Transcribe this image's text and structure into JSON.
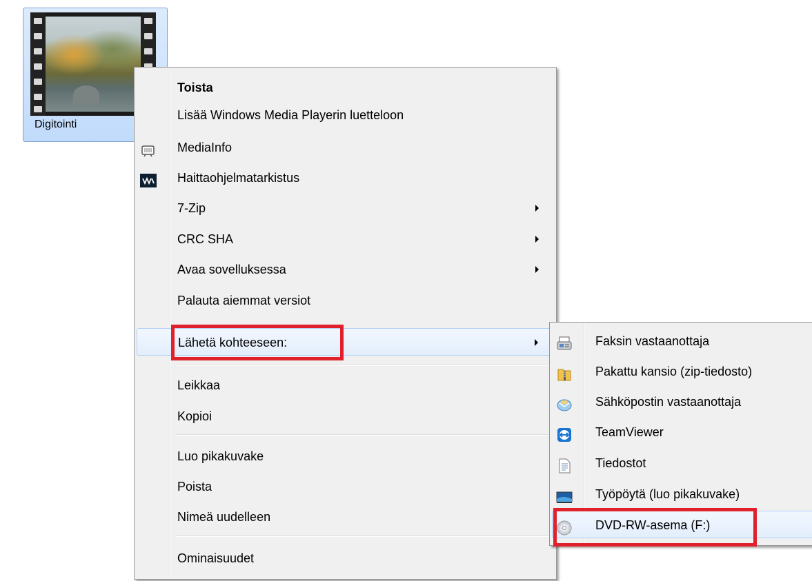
{
  "file": {
    "label": "Digitointi",
    "icon": "video-thumbnail-icon"
  },
  "context_menu": {
    "items": [
      {
        "label": "Toista",
        "bold": true
      },
      {
        "label": "Lisää Windows Media Playerin luetteloon"
      },
      {
        "label": "MediaInfo",
        "icon": "mediainfo-icon"
      },
      {
        "label": "Haittaohjelmatarkistus",
        "icon": "malware-scan-icon"
      },
      {
        "label": "7-Zip",
        "submenu": true
      },
      {
        "label": "CRC SHA",
        "submenu": true
      },
      {
        "label": "Avaa sovelluksessa",
        "submenu": true
      },
      {
        "label": "Palauta aiemmat versiot"
      },
      {
        "label": "Lähetä kohteeseen:",
        "submenu": true,
        "highlighted": true
      },
      {
        "label": "Leikkaa"
      },
      {
        "label": "Kopioi"
      },
      {
        "label": "Luo pikakuvake"
      },
      {
        "label": "Poista"
      },
      {
        "label": "Nimeä uudelleen"
      },
      {
        "label": "Ominaisuudet"
      }
    ]
  },
  "send_to_menu": {
    "items": [
      {
        "label": "Faksin vastaanottaja",
        "icon": "fax-icon"
      },
      {
        "label": "Pakattu kansio (zip-tiedosto)",
        "icon": "zip-folder-icon"
      },
      {
        "label": "Sähköpostin vastaanottaja",
        "icon": "mail-recipient-icon"
      },
      {
        "label": "TeamViewer",
        "icon": "teamviewer-icon"
      },
      {
        "label": "Tiedostot",
        "icon": "documents-icon"
      },
      {
        "label": "Työpöytä (luo pikakuvake)",
        "icon": "desktop-icon"
      },
      {
        "label": "DVD-RW-asema (F:)",
        "icon": "dvd-drive-icon",
        "highlighted": true
      }
    ]
  },
  "colors": {
    "annotation_red": "#e0202a",
    "menu_background": "#f0f0f0",
    "highlight_border": "#aecff7"
  }
}
